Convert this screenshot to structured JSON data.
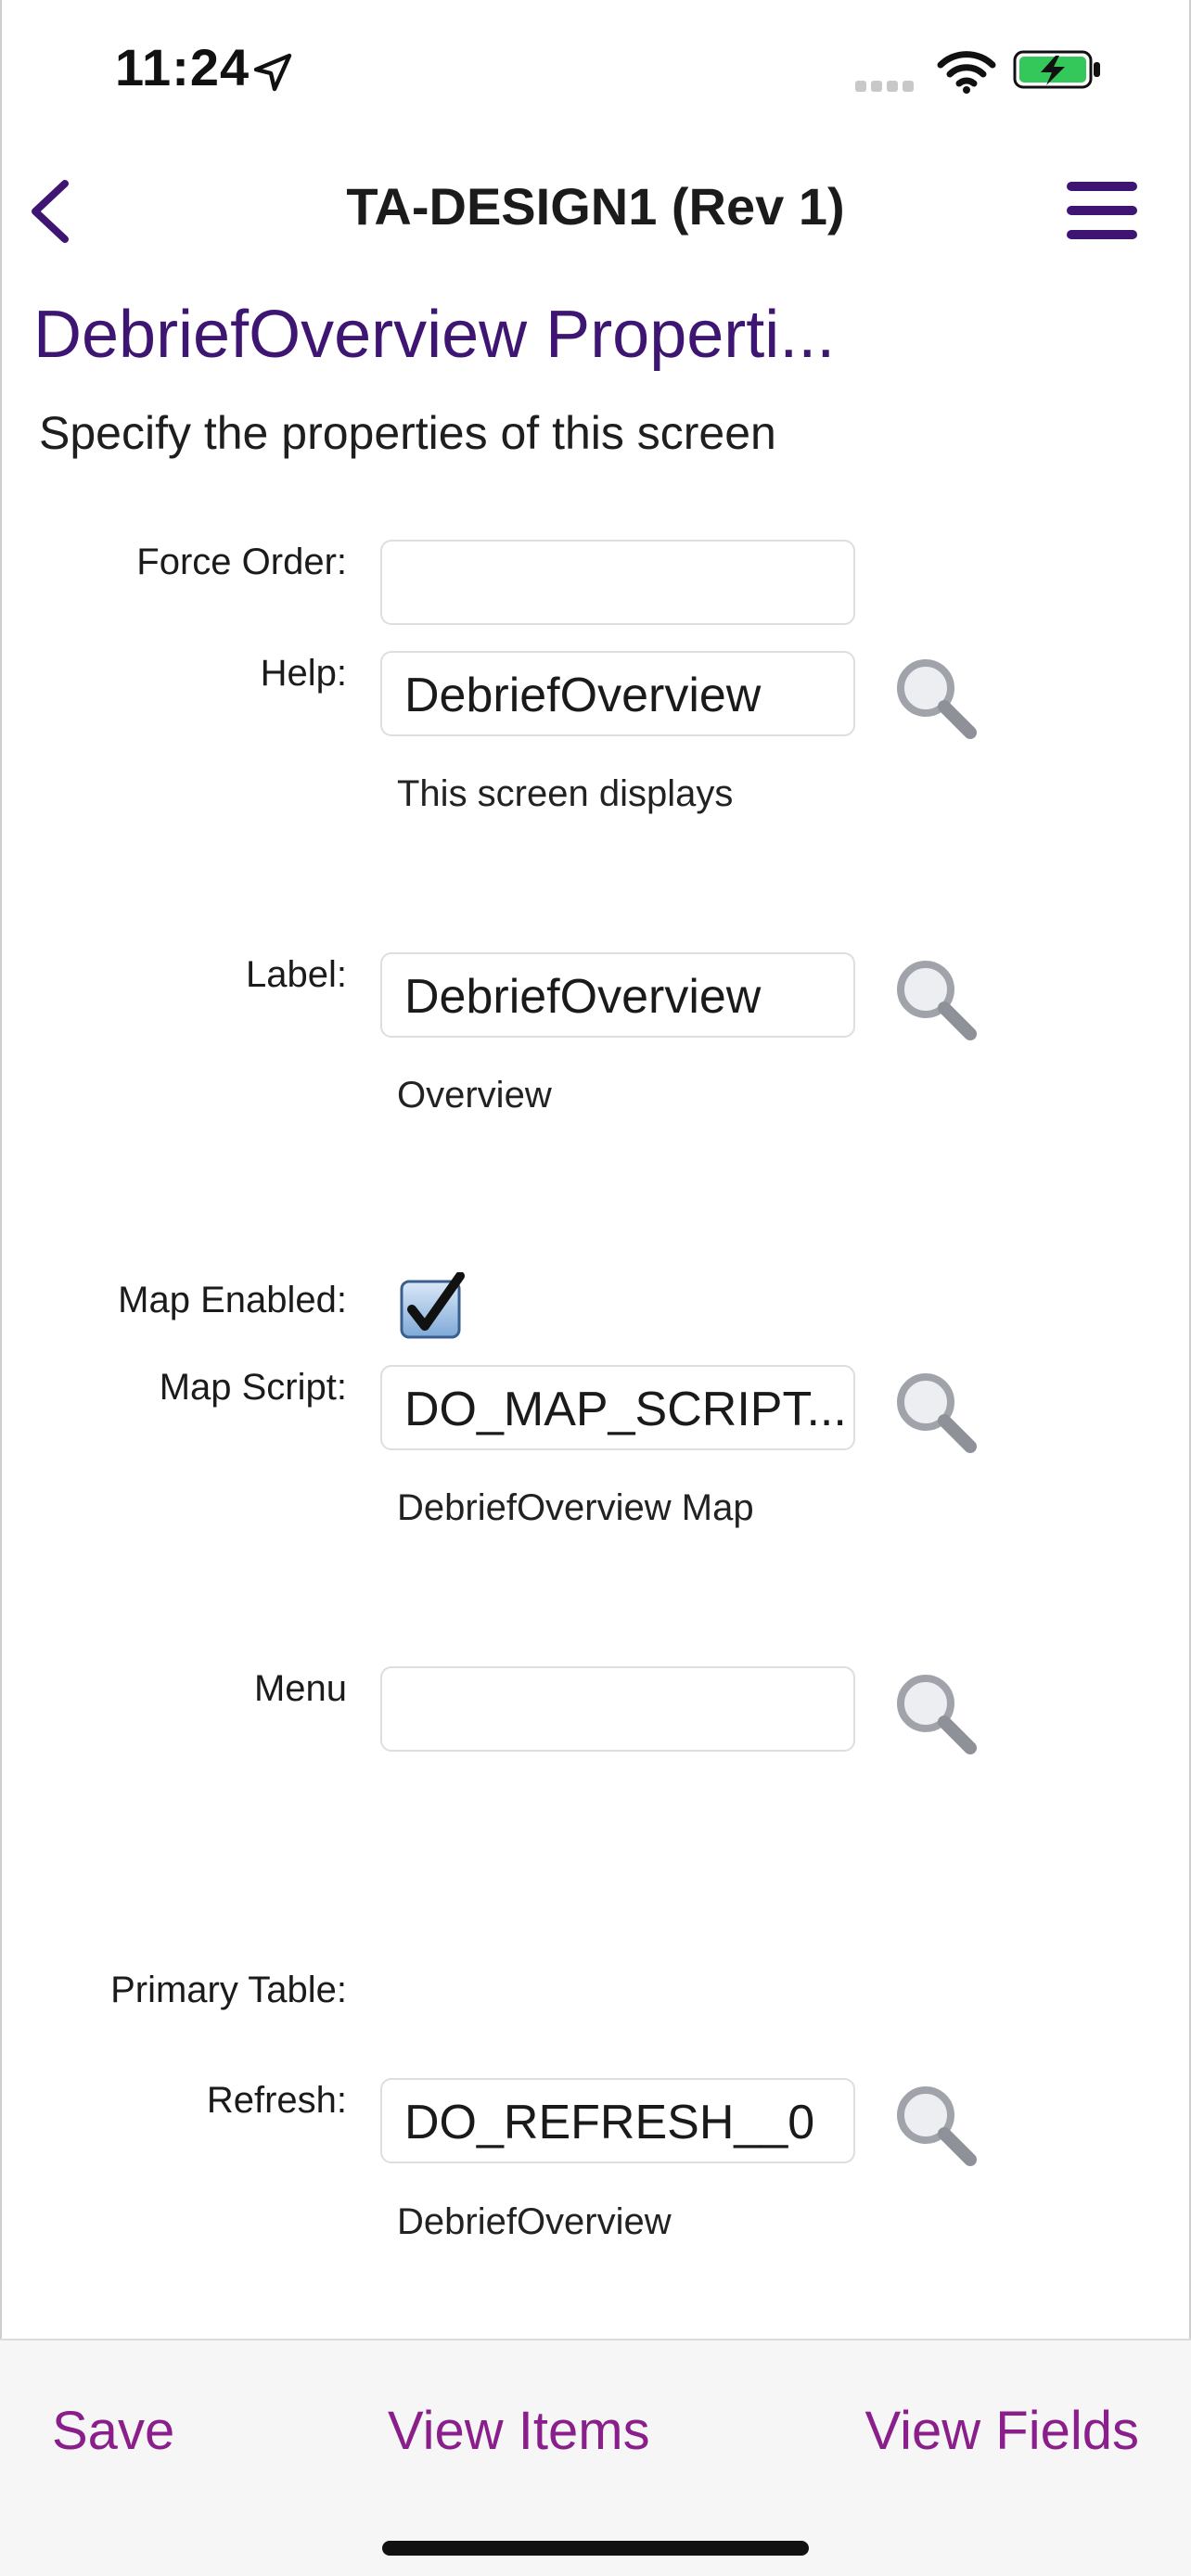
{
  "status_bar": {
    "time": "11:24"
  },
  "nav": {
    "title": "TA-DESIGN1 (Rev 1)"
  },
  "page": {
    "title": "DebriefOverview Properti...",
    "subtitle": "Specify the properties of this screen"
  },
  "form": {
    "force_order": {
      "label": "Force Order:",
      "value": ""
    },
    "help": {
      "label": "Help:",
      "value": "DebriefOverview",
      "description": "This screen displays"
    },
    "label_field": {
      "label": "Label:",
      "value": "DebriefOverview",
      "description": "Overview"
    },
    "map_enabled": {
      "label": "Map Enabled:",
      "checked": true
    },
    "map_script": {
      "label": "Map Script:",
      "value": "DO_MAP_SCRIPT...",
      "description": "DebriefOverview Map"
    },
    "menu": {
      "label": "Menu",
      "value": ""
    },
    "primary_table": {
      "label": "Primary Table:"
    },
    "refresh": {
      "label": "Refresh:",
      "value": "DO_REFRESH__0",
      "description": "DebriefOverview"
    }
  },
  "toolbar": {
    "save": "Save",
    "view_items": "View Items",
    "view_fields": "View Fields"
  },
  "icons": {
    "back": "chevron-left-icon",
    "menu": "hamburger-menu-icon",
    "lookup": "magnifier-icon",
    "checkbox": "checkmark-icon"
  },
  "colors": {
    "accent": "#3e1572",
    "toolbar_text": "#8a1f8c",
    "battery": "#34c759"
  }
}
